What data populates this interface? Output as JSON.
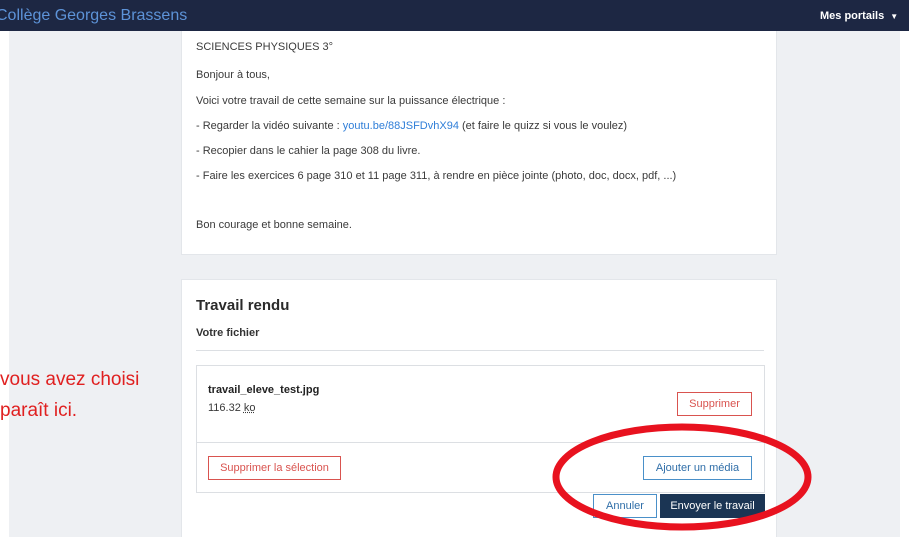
{
  "header": {
    "brand": "Collège Georges Brassens",
    "portals_label": "Mes portails",
    "portals_caret": "▼"
  },
  "assignment": {
    "subject": "SCIENCES PHYSIQUES 3°",
    "greeting": "Bonjour à tous,",
    "intro": "Voici votre travail de cette semaine sur la puissance électrique :",
    "item1_prefix": "- Regarder la vidéo suivante : ",
    "item1_link": "youtu.be/88JSFDvhX94",
    "item1_suffix": "  (et faire le quizz si vous le voulez)",
    "item2": "- Recopier dans le cahier la page 308 du livre.",
    "item3": "- Faire les exercices 6 page 310 et 11 page 311, à rendre en pièce jointe (photo, doc, docx, pdf, ...)",
    "closing": "Bon courage et bonne semaine."
  },
  "submission": {
    "title": "Travail rendu",
    "subtitle": "Votre fichier",
    "file_name": "travail_eleve_test.jpg",
    "file_size_value": "116.32",
    "file_size_unit": "ko",
    "delete_label": "Supprimer",
    "delete_selection_label": "Supprimer la sélection",
    "add_media_label": "Ajouter un média",
    "cancel_label": "Annuler",
    "send_label": "Envoyer le travail"
  },
  "annotation": {
    "line1": "vous avez choisi",
    "line2": "paraît ici.",
    "color": "#e02020",
    "highlight_shape": "ellipse"
  },
  "colors": {
    "topbar": "#1d2743",
    "brand_text": "#5d93d8",
    "link": "#2f7ed8",
    "danger": "#d9534f",
    "primary_dark": "#1b3554"
  }
}
